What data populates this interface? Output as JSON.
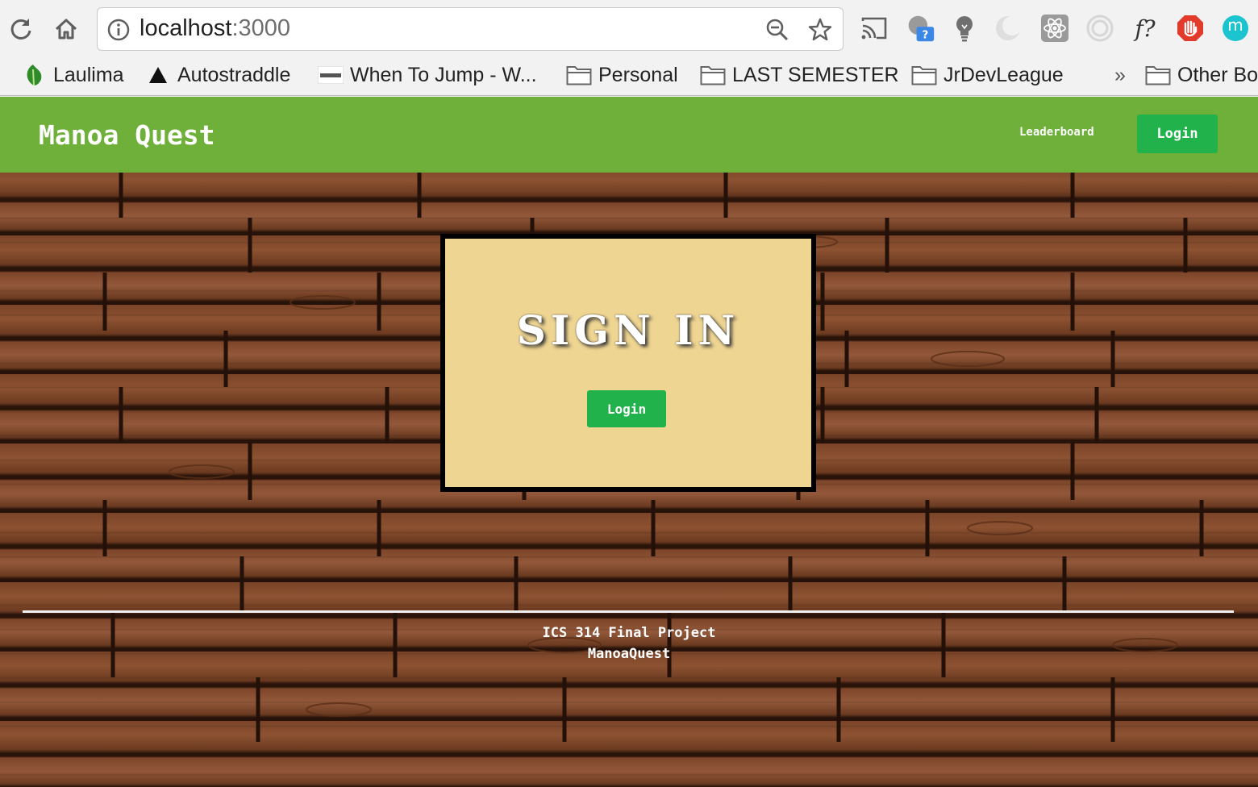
{
  "browser": {
    "url_host": "localhost",
    "url_port": ":3000",
    "extensions": [
      "cast-icon",
      "help-extension-icon",
      "lightbulb-icon",
      "crescent-icon",
      "react-icon",
      "circle-target-icon",
      "font-identify-icon",
      "stop-hand-icon",
      "user-avatar-icon"
    ],
    "extension_font_label": "f?",
    "avatar_letter": "m"
  },
  "bookmarks": {
    "items": [
      {
        "label": "Laulima",
        "icon": "leaf-icon"
      },
      {
        "label": "Autostraddle",
        "icon": "triangle-icon"
      },
      {
        "label": "When To Jump - W...",
        "icon": "jump-logo-icon"
      },
      {
        "label": "Personal",
        "icon": "folder-icon"
      },
      {
        "label": "LAST SEMESTER",
        "icon": "folder-icon"
      },
      {
        "label": "JrDevLeague",
        "icon": "folder-icon"
      }
    ],
    "overflow": "»",
    "other": "Other Bo"
  },
  "navbar": {
    "brand": "Manoa Quest",
    "leaderboard": "Leaderboard",
    "login": "Login"
  },
  "card": {
    "title": "SIGN IN",
    "login": "Login"
  },
  "footer": {
    "line1": "ICS 314 Final Project",
    "line2": "ManoaQuest"
  },
  "colors": {
    "navbar": "#6eb03a",
    "button": "#22b24b",
    "card": "#efd592",
    "wood": "#7a4428"
  }
}
